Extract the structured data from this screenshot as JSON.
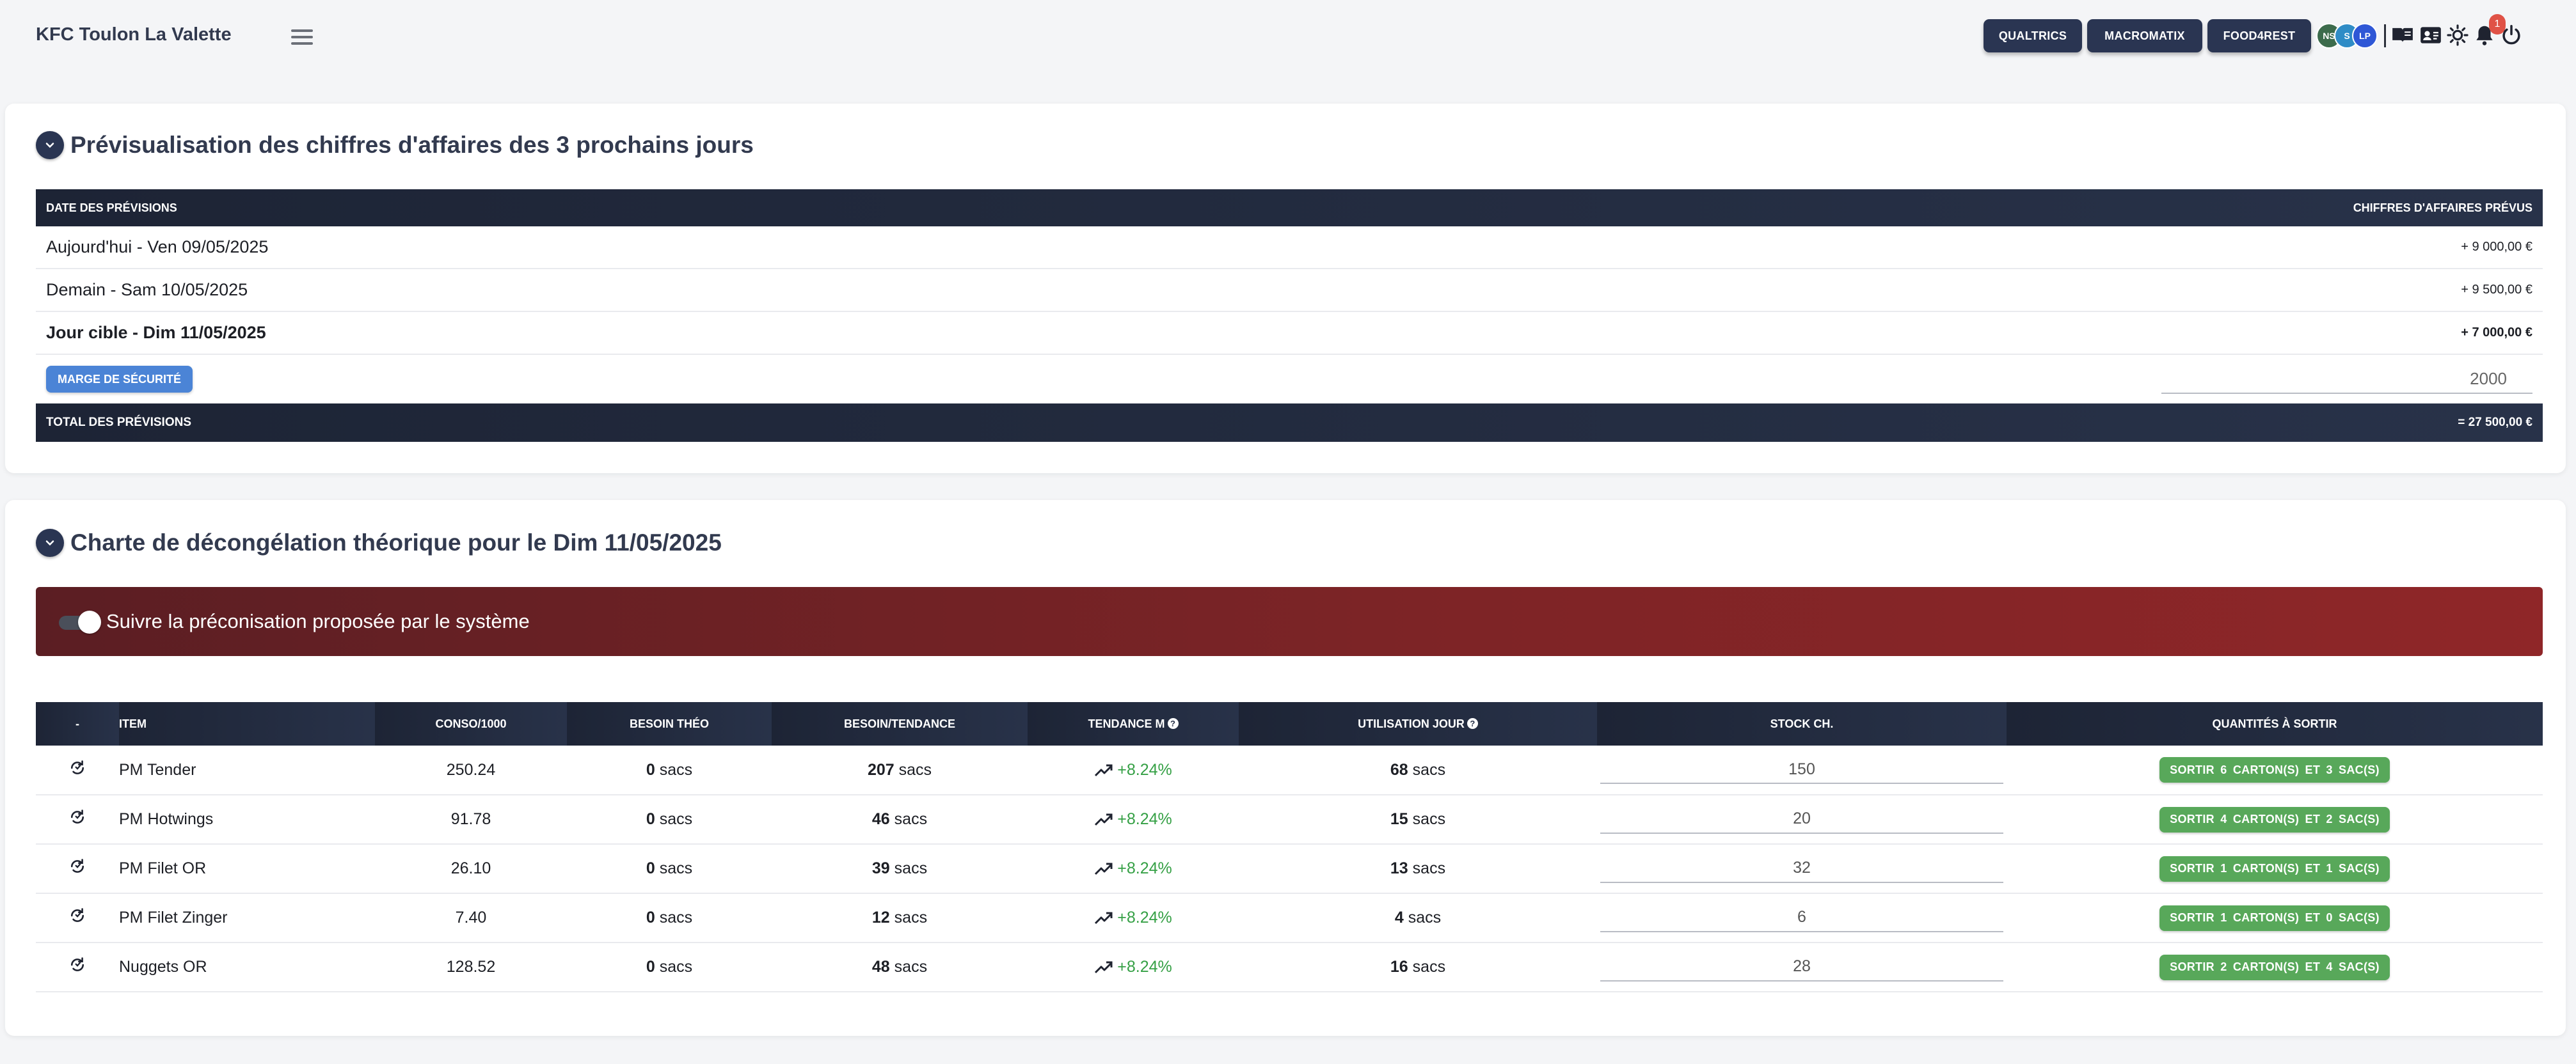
{
  "app": {
    "title": "KFC Toulon La Valette"
  },
  "toolbar": {
    "buttons": [
      "QUALTRICS",
      "MACROMATIX",
      "FOOD4REST"
    ],
    "avatars": [
      {
        "initials": "NS",
        "color": "#3c6b4c"
      },
      {
        "initials": "S",
        "color": "#2f8cc6"
      },
      {
        "initials": "LP",
        "color": "#2f57d6"
      }
    ],
    "notification_count": "1"
  },
  "forecast": {
    "title": "Prévisualisation des chiffres d'affaires des 3 prochains jours",
    "header_left": "DATE DES PRÉVISIONS",
    "header_right": "CHIFFRES D'AFFAIRES PRÉVUS",
    "rows": [
      {
        "label": "Aujourd'hui - Ven 09/05/2025",
        "amount": "+ 9 000,00 €"
      },
      {
        "label": "Demain - Sam 10/05/2025",
        "amount": "+ 9 500,00 €"
      },
      {
        "label": "Jour cible - Dim 11/05/2025",
        "amount": "+ 7 000,00 €"
      }
    ],
    "marge_label": "MARGE DE SÉCURITÉ",
    "marge_value": "2000",
    "total_label": "TOTAL DES PRÉVISIONS",
    "total_value": "= 27 500,00 €"
  },
  "chart": {
    "title": "Charte de décongélation théorique pour le Dim 11/05/2025",
    "toggle_label": "Suivre la préconisation proposée par le système",
    "columns": [
      "-",
      "ITEM",
      "CONSO/1000",
      "BESOIN THÉO",
      "BESOIN/TENDANCE",
      "TENDANCE M",
      "UTILISATION JOUR",
      "STOCK CH.",
      "QUANTITÉS À SORTIR"
    ],
    "unit": "sacs",
    "rows": [
      {
        "item": "PM Tender",
        "conso": "250.24",
        "besoin_theo": "0",
        "besoin_tendance": "207",
        "tendance": "+8.24%",
        "utilisation": "68",
        "stock": "150",
        "sortir": "SORTIR 6 CARTON(S) ET 3 SAC(S)"
      },
      {
        "item": "PM Hotwings",
        "conso": "91.78",
        "besoin_theo": "0",
        "besoin_tendance": "46",
        "tendance": "+8.24%",
        "utilisation": "15",
        "stock": "20",
        "sortir": "SORTIR 4 CARTON(S) ET 2 SAC(S)"
      },
      {
        "item": "PM Filet OR",
        "conso": "26.10",
        "besoin_theo": "0",
        "besoin_tendance": "39",
        "tendance": "+8.24%",
        "utilisation": "13",
        "stock": "32",
        "sortir": "SORTIR 1 CARTON(S) ET 1 SAC(S)"
      },
      {
        "item": "PM Filet Zinger",
        "conso": "7.40",
        "besoin_theo": "0",
        "besoin_tendance": "12",
        "tendance": "+8.24%",
        "utilisation": "4",
        "stock": "6",
        "sortir": "SORTIR 1 CARTON(S) ET 0 SAC(S)"
      },
      {
        "item": "Nuggets OR",
        "conso": "128.52",
        "besoin_theo": "0",
        "besoin_tendance": "48",
        "tendance": "+8.24%",
        "utilisation": "16",
        "stock": "28",
        "sortir": "SORTIR 2 CARTON(S) ET 4 SAC(S)"
      }
    ]
  }
}
